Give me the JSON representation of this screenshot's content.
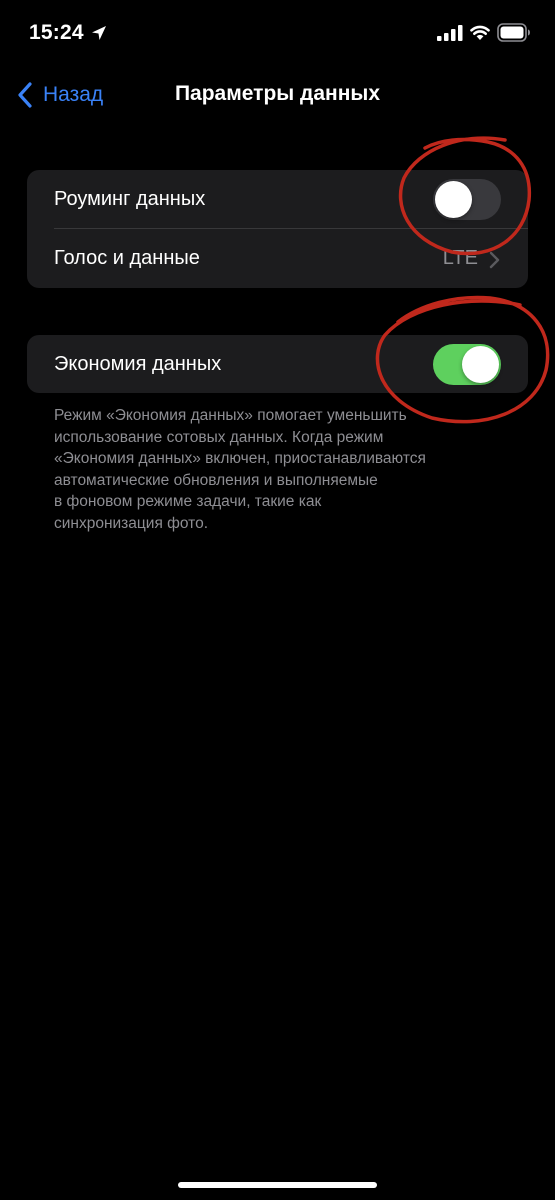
{
  "status_bar": {
    "time": "15:24",
    "icons": [
      "location-arrow-icon",
      "cellular-signal-icon",
      "wifi-icon",
      "battery-icon"
    ]
  },
  "nav": {
    "back_label": "Назад",
    "title": "Параметры данных",
    "accent_color": "#3a82f7"
  },
  "group1": {
    "roaming": {
      "label": "Роуминг данных",
      "toggle_state": "off"
    },
    "voice_data": {
      "label": "Голос и данные",
      "value": "LTE"
    }
  },
  "group2": {
    "low_data": {
      "label": "Экономия данных",
      "toggle_state": "on",
      "toggle_color": "#5ed05e"
    }
  },
  "footer": {
    "lines": [
      "Режим «Экономия данных» помогает уменьшить",
      "использование сотовых данных. Когда режим",
      "«Экономия данных» включен, приостанавливаются",
      "автоматические обновления и выполняемые",
      "в фоновом режиме задачи, такие как",
      "синхронизация фото."
    ]
  },
  "annotation_color": "#c0281c"
}
